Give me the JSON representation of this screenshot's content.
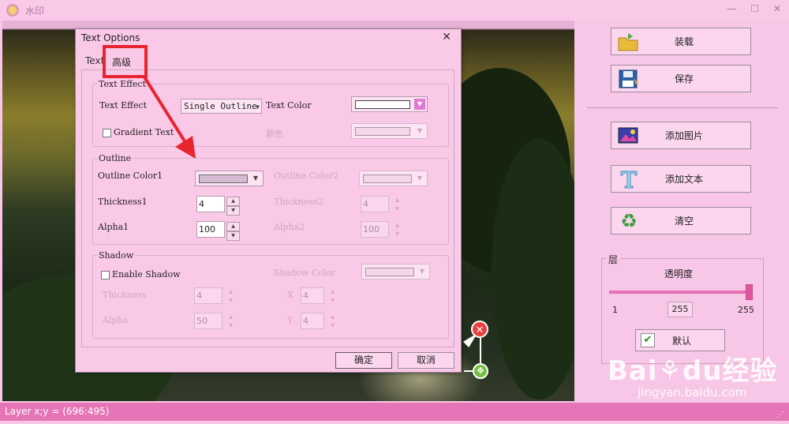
{
  "window": {
    "title": "水印",
    "controls": [
      "—",
      "☐",
      "✕"
    ]
  },
  "status_bar": {
    "text": "Layer x;y = (696:495)",
    "grip": "⋰"
  },
  "right_panel": {
    "load_label": "装载",
    "save_label": "保存",
    "add_image_label": "添加图片",
    "add_text_label": "添加文本",
    "clear_label": "清空",
    "layer_group_title": "层",
    "opacity_label": "透明度",
    "opacity_min": "1",
    "opacity_max": "255",
    "opacity_value": "255",
    "opacity_level": 255,
    "default_label": "默认",
    "default_checked": true
  },
  "watermark": {
    "logo": "Bai⚘du经验",
    "url": "jingyan.baidu.com"
  },
  "dialog": {
    "title": "Text Options",
    "close": "✕",
    "tabs": [
      "Text",
      "高级"
    ],
    "text_effect_group": "Text Effect",
    "text_effect_label": "Text Effect",
    "text_effect_value": "Single Outline",
    "text_color_label": "Text Color",
    "gradient_text_label": "Gradient Text",
    "gradient_color_label": "颜色",
    "outline_group": "Outline",
    "outline_color1_label": "Outline Color1",
    "outline_color2_label": "Outline Color2",
    "thickness1_label": "Thickness1",
    "thickness1_value": "4",
    "thickness2_label": "Thickness2",
    "thickness2_value": "4",
    "alpha1_label": "Alpha1",
    "alpha1_value": "100",
    "alpha2_label": "Alpha2",
    "alpha2_value": "100",
    "shadow_group": "Shadow",
    "enable_shadow_label": "Enable Shadow",
    "shadow_color_label": "Shadow Color",
    "shadow_thickness_label": "Thickness",
    "shadow_thickness_value": "4",
    "shadow_x_label": "X",
    "shadow_x_value": "4",
    "shadow_alpha_label": "Alpha",
    "shadow_alpha_value": "50",
    "shadow_y_label": "Y",
    "shadow_y_value": "4",
    "ok_label": "确定",
    "cancel_label": "取消"
  },
  "colors": {
    "accent": "#e575b7",
    "annotation": "#e8252e",
    "background": "#f8c6e6"
  }
}
